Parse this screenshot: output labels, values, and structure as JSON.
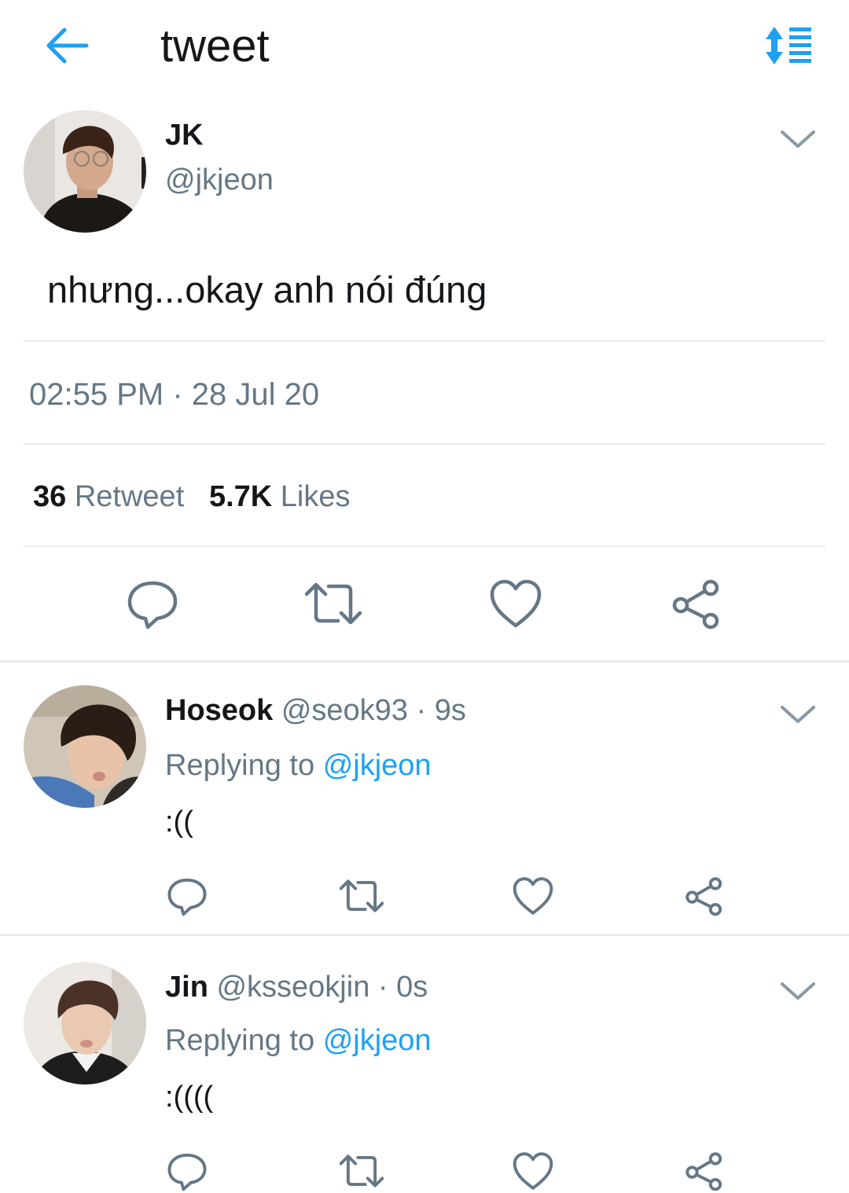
{
  "header": {
    "title": "tweet",
    "back_icon": "arrow-left-icon",
    "sort_icon": "sort-list-icon",
    "accent": "#1da1f2"
  },
  "tweet": {
    "display_name": "JK",
    "handle": "@jkjeon",
    "text": "nhưng...okay anh nói đúng",
    "timestamp": "02:55 PM · 28 Jul 20",
    "retweet_count": "36",
    "retweet_label": "Retweet",
    "like_count": "5.7K",
    "like_label": "Likes"
  },
  "replies": [
    {
      "display_name": "Hoseok",
      "handle": "@seok93",
      "time": "· 9s",
      "replying_prefix": "Replying to",
      "replying_to": "@jkjeon",
      "text": ":(("
    },
    {
      "display_name": "Jin",
      "handle": "@ksseokjin",
      "time": "· 0s",
      "replying_prefix": "Replying to",
      "replying_to": "@jkjeon",
      "text": ":(((("
    }
  ],
  "icons": {
    "reply": "speech-bubble-icon",
    "retweet": "retweet-icon",
    "like": "heart-icon",
    "share": "share-icon",
    "menu": "chevron-down-icon"
  },
  "colors": {
    "text": "#14171a",
    "muted": "#657786",
    "link": "#1da1f2",
    "divider": "#e6ecf0"
  }
}
